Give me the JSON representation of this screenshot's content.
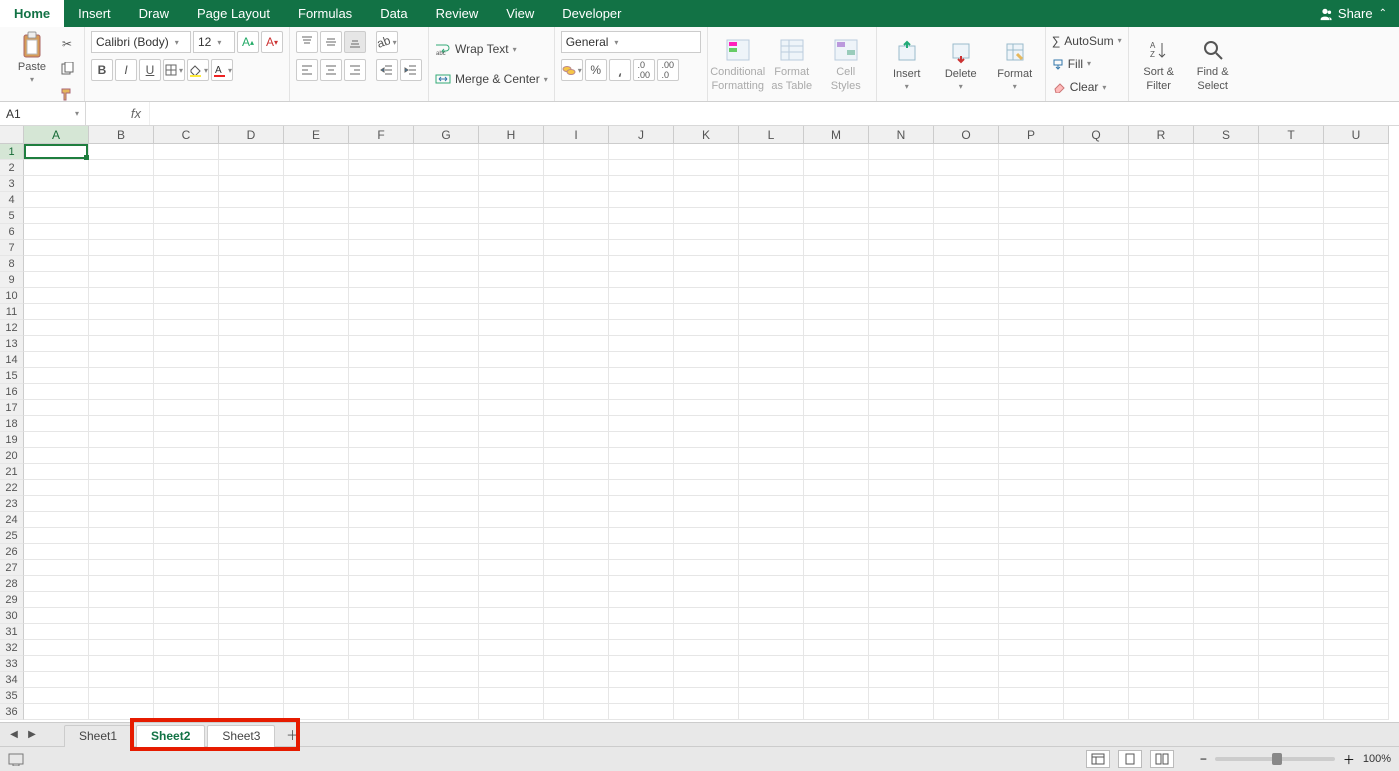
{
  "tabs": {
    "items": [
      "Home",
      "Insert",
      "Draw",
      "Page Layout",
      "Formulas",
      "Data",
      "Review",
      "View",
      "Developer"
    ],
    "active": "Home",
    "share_label": "Share"
  },
  "ribbon": {
    "paste_label": "Paste",
    "font_name": "Calibri (Body)",
    "font_size": "12",
    "wrap_text": "Wrap Text",
    "merge_center": "Merge & Center",
    "number_format": "General",
    "cond_fmt_l1": "Conditional",
    "cond_fmt_l2": "Formatting",
    "fmt_table_l1": "Format",
    "fmt_table_l2": "as Table",
    "cell_styles_l1": "Cell",
    "cell_styles_l2": "Styles",
    "insert": "Insert",
    "delete": "Delete",
    "format": "Format",
    "autosum": "AutoSum",
    "fill": "Fill",
    "clear": "Clear",
    "sort_l1": "Sort &",
    "sort_l2": "Filter",
    "find_l1": "Find &",
    "find_l2": "Select"
  },
  "formula": {
    "name": "A1",
    "fx": "fx",
    "value": ""
  },
  "grid": {
    "columns": [
      "A",
      "B",
      "C",
      "D",
      "E",
      "F",
      "G",
      "H",
      "I",
      "J",
      "K",
      "L",
      "M",
      "N",
      "O",
      "P",
      "Q",
      "R",
      "S",
      "T",
      "U"
    ],
    "rows": [
      "1",
      "2",
      "3",
      "4",
      "5",
      "6",
      "7",
      "8",
      "9",
      "10",
      "11",
      "12",
      "13",
      "14",
      "15",
      "16",
      "17",
      "18",
      "19",
      "20",
      "21",
      "22",
      "23",
      "24",
      "25",
      "26",
      "27",
      "28",
      "29",
      "30",
      "31",
      "32",
      "33",
      "34",
      "35",
      "36"
    ],
    "active_cell": "A1"
  },
  "sheets": {
    "items": [
      "Sheet1",
      "Sheet2",
      "Sheet3"
    ],
    "active": "Sheet2",
    "highlighted_range": [
      "Sheet2",
      "Sheet3"
    ]
  },
  "status": {
    "zoom": "100%"
  }
}
